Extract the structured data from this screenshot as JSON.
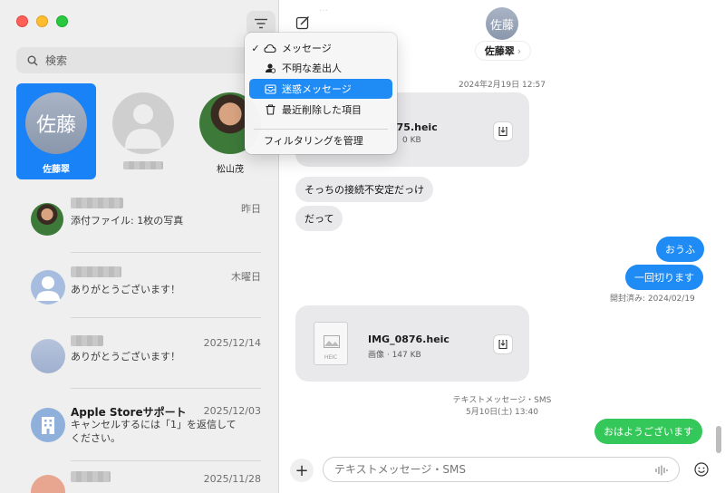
{
  "sidebar": {
    "search_placeholder": "検索",
    "pinned": [
      {
        "initials": "佐藤",
        "name": "佐藤翠",
        "selected": true
      },
      {
        "initials": "",
        "name": "",
        "selected": false
      },
      {
        "initials": "",
        "name": "松山茂",
        "selected": false
      }
    ],
    "conversations": [
      {
        "date": "昨日",
        "preview": "添付ファイル: 1枚の写真"
      },
      {
        "date": "木曜日",
        "preview": "ありがとうございます！"
      },
      {
        "date": "2025/12/14",
        "preview": "ありがとうございます！"
      },
      {
        "title": "Apple Storeサポート",
        "date": "2025/12/03",
        "preview": "キャンセルするには「1」を返信してください。"
      },
      {
        "date": "2025/11/28",
        "preview": ""
      }
    ]
  },
  "menu": {
    "items": [
      {
        "label": "メッセージ",
        "checked": true,
        "icon": "cloud-bubble-icon"
      },
      {
        "label": "不明な差出人",
        "checked": false,
        "icon": "unknown-sender-icon"
      },
      {
        "label": "迷惑メッセージ",
        "checked": false,
        "icon": "junk-tray-icon",
        "active": true
      },
      {
        "label": "最近削除した項目",
        "checked": false,
        "icon": "trash-icon"
      }
    ],
    "manage_label": "フィルタリングを管理",
    "checkmark": "✓"
  },
  "chat": {
    "contact_initials": "佐藤",
    "contact_name": "佐藤翠",
    "contact_chevron": "›",
    "timestamp1": "2024年2月19日 12:57",
    "file1": {
      "name": "875.heic",
      "meta": "0 KB"
    },
    "msg_in_1": "そっちの接続不安定だっけ",
    "msg_in_2": "だって",
    "msg_out_1": "おうふ",
    "msg_out_2": "一回切ります",
    "read_receipt": "開封済み: 2024/02/19",
    "file2": {
      "name": "IMG_0876.heic",
      "meta": "画像 · 147 KB",
      "doc_label": "HEIC"
    },
    "timestamp2_line1": "テキストメッセージ・SMS",
    "timestamp2_line2": "5月10日(土) 13:40",
    "msg_out_green": "おはようございます",
    "composer_placeholder": "テキストメッセージ・SMS",
    "plus_label": "+"
  },
  "colors": {
    "accent": "#1a82f7",
    "imessage_blue": "#1f8bf5",
    "sms_green": "#34c759"
  }
}
